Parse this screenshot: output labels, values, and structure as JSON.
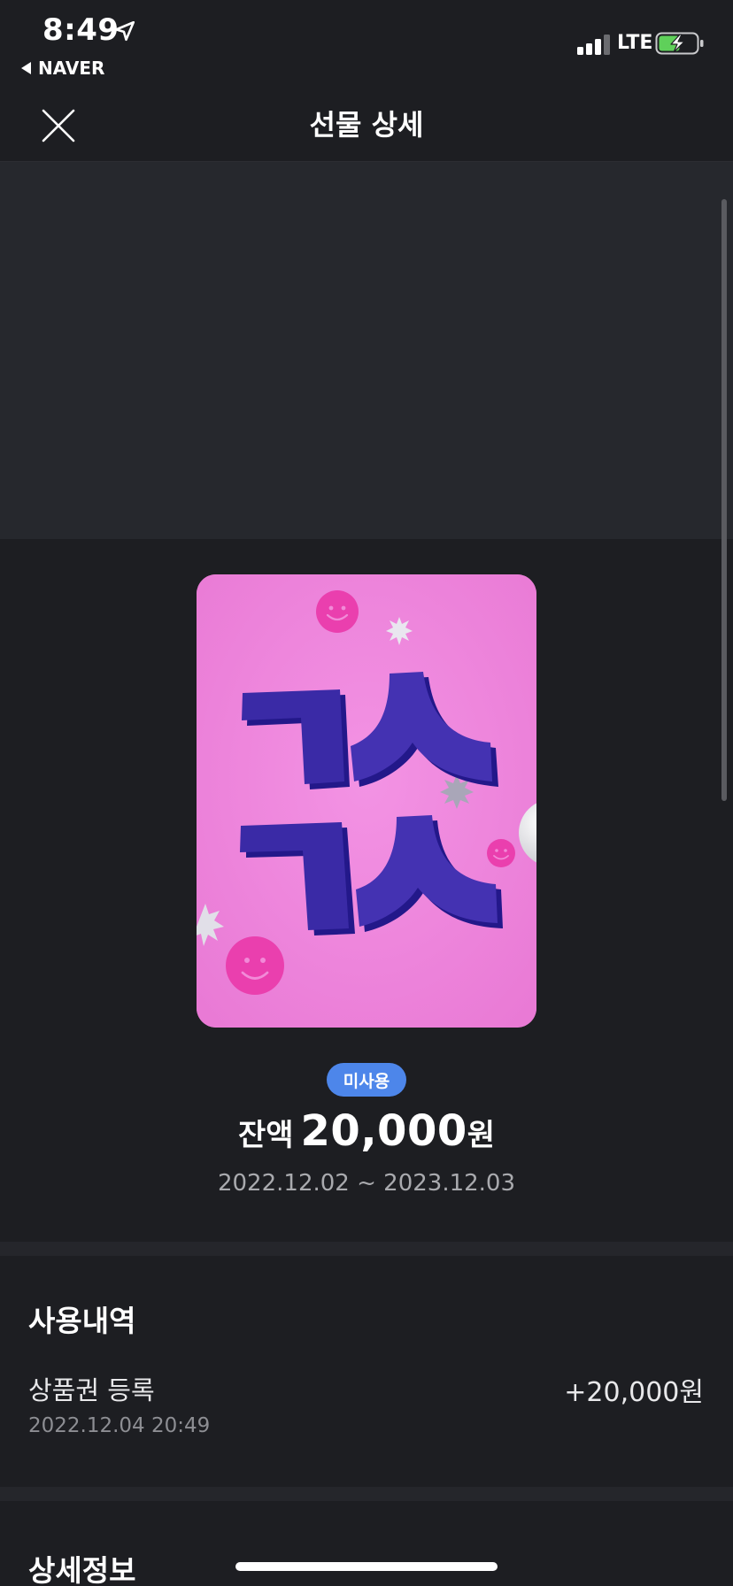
{
  "status_bar": {
    "time": "8:49",
    "back_app": "NAVER",
    "network": "LTE",
    "icons": [
      "location-arrow-icon",
      "signal-icon",
      "battery-charging-icon"
    ]
  },
  "nav": {
    "title": "선물 상세",
    "close_icon": "close-icon"
  },
  "gift": {
    "status": "미사용",
    "balance_label": "잔액",
    "balance_amount": "20,000",
    "balance_unit": "원",
    "validity": "2022.12.02 ~ 2023.12.03",
    "card_colors": {
      "background": "#ef86dc",
      "letters": "#3a2aa6",
      "smiley": "#ea3fae"
    }
  },
  "history": {
    "heading": "사용내역",
    "items": [
      {
        "title": "상품권 등록",
        "amount": "+20,000원",
        "date": "2022.12.04 20:49"
      }
    ]
  },
  "details": {
    "heading": "상세정보"
  },
  "colors": {
    "background": "#1d1e22",
    "banner": "#26282d",
    "badge": "#4d86ea",
    "muted_text": "#a9aaae"
  }
}
